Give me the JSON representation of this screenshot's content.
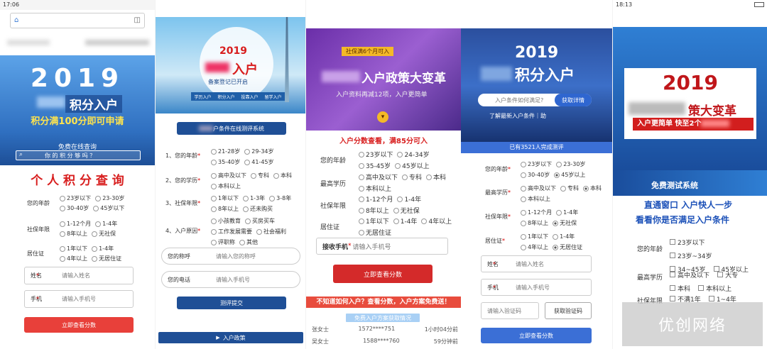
{
  "p1": {
    "time": "17:06",
    "year": "2019",
    "title": "积分入户",
    "subtitle": "积分满100分即可申请",
    "free_query": "免费在线查询",
    "search_ph": "你 的 积 分 够 吗 ？",
    "query_title": "个 人 积 分 查 询",
    "age_label": "您的年龄",
    "age_opts": [
      "23岁以下",
      "23-30岁",
      "30-40岁",
      "45岁以下"
    ],
    "ss_label": "社保年限",
    "ss_opts": [
      "1-12个月",
      "1-4年",
      "8年以上",
      "无社保"
    ],
    "res_label": "居住证",
    "res_opts": [
      "1年以下",
      "1-4年",
      "4年以上",
      "无居住证"
    ],
    "name_label": "姓名",
    "name_ph": "请输入姓名",
    "phone_label": "手机",
    "phone_ph": "请输入手机号",
    "submit": "立即查看分数"
  },
  "p2": {
    "year": "2019",
    "title": "入户",
    "banner_sub": "备案登记已开启",
    "tags": [
      "学历入户",
      "积分入户",
      "投靠入户",
      "留学入户"
    ],
    "sys_btn": "户条件在线测评系统",
    "q1": "1、您的年龄",
    "q1_opts": [
      "21-28岁",
      "29-34岁",
      "35-40岁",
      "41-45岁"
    ],
    "q2": "2、您的学历",
    "q2_opts": [
      "高中及以下",
      "专科",
      "本科",
      "本科以上"
    ],
    "q3": "3、社保年限",
    "q3_opts": [
      "1年以下",
      "1-3年",
      "3-8年",
      "8年以上",
      "还未购买"
    ],
    "q4": "4、入户原因",
    "q4_opts": [
      "小孩教育",
      "买房买车",
      "工作发展需要",
      "社会福利",
      "评职称",
      "其他"
    ],
    "name_label": "您的称呼",
    "name_ph": "请输入您的称呼",
    "phone_label": "您的电话",
    "phone_ph": "请输入手机号",
    "submit": "测评提交",
    "bottom": "入户政策"
  },
  "p3": {
    "tag": "社保满6个月可入",
    "title": "入户政策大变革",
    "sub": "入户资料再减12项，入户更简单",
    "headline": "入户分数查看，满85分可入",
    "age_label": "您的年龄",
    "age_opts": [
      "23岁以下",
      "24-34岁",
      "35-45岁",
      "45岁以上"
    ],
    "edu_label": "最高学历",
    "edu_opts": [
      "高中及以下",
      "专科",
      "本科",
      "本科以上"
    ],
    "ss_label": "社保年限",
    "ss_opts": [
      "1-12个月",
      "1-4年",
      "8年以上",
      "无社保"
    ],
    "res_label": "居住证",
    "res_opts": [
      "1年以下",
      "1-4年",
      "4年以上",
      "无居住证"
    ],
    "phone_label": "接收手机",
    "phone_ph": "请输入手机号",
    "submit": "立即查看分数",
    "promo": "不知道如何入户？查看分数，入户方案免费送！",
    "promo_btn": "免费入户方案获取情况",
    "records": [
      {
        "name": "张女士",
        "phone": "1572****751",
        "time": "1小时04分前"
      },
      {
        "name": "吴女士",
        "phone": "1588****760",
        "time": "59分钟前"
      }
    ]
  },
  "p4": {
    "year": "2019",
    "title": "积分入户",
    "search_ph": "入户条件如何满足?",
    "search_btn": "获取详情",
    "latest": "了解最新入户条件｜助",
    "count_bar": "已有3521人完成测评",
    "age_label": "您的年龄",
    "age_opts": [
      "23岁以下",
      "23-30岁",
      "30-40岁",
      "45岁以上"
    ],
    "edu_label": "最高学历",
    "edu_opts": [
      "高中及以下",
      "专科",
      "本科",
      "本科以上"
    ],
    "ss_label": "社保年限",
    "ss_opts": [
      "1-12个月",
      "1-4年",
      "8年以上",
      "无社保"
    ],
    "res_label": "居住证",
    "res_opts": [
      "1年以下",
      "1-4年",
      "4年以上",
      "无居住证"
    ],
    "name_label": "姓名",
    "name_ph": "请输入姓名",
    "phone_label": "手机",
    "phone_ph": "请输入手机号",
    "code_ph": "请输入验证码",
    "code_btn": "获取验证码",
    "submit": "立即查看分数"
  },
  "p5": {
    "time": "18:13",
    "year": "2019",
    "title": "策大变革",
    "red_banner": "入户更简单 快至2个",
    "free_test": "免费测试系统",
    "line1": "直通窗口 入户快人一步",
    "line2": "看看你是否满足入户条件",
    "age_label": "您的年龄",
    "age_opts": [
      "23岁以下",
      "23岁~34岁",
      "34~45岁",
      "45岁以上"
    ],
    "edu_label": "最高学历",
    "edu_opts": [
      "高中及以下",
      "大专",
      "本科",
      "本科以上"
    ],
    "ss_label": "社保年限",
    "ss_opts": [
      "不满1年",
      "1~4年"
    ]
  },
  "watermark": "优创网络"
}
